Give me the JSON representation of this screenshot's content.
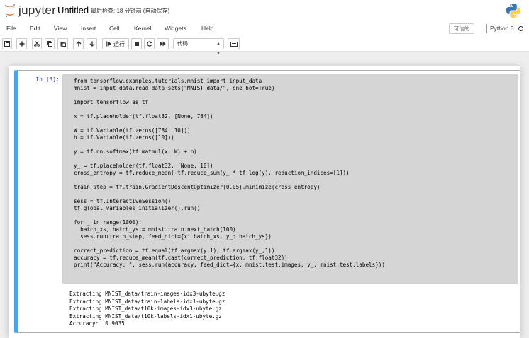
{
  "header": {
    "logo_text": "jupyter",
    "notebook_name": "Untitled",
    "checkpoint": "最后检查: 18 分钟前  (自动保存)"
  },
  "menubar": {
    "items": [
      "File",
      "Edit",
      "View",
      "Insert",
      "Cell",
      "Kernel",
      "Widgets",
      "Help"
    ],
    "trusted": "可信的",
    "kernel_name": "Python 3"
  },
  "toolbar": {
    "run_label": "运行",
    "cell_type": "代码"
  },
  "cell": {
    "prompt": "In [3]:",
    "code": "from tensorflow.examples.tutorials.mnist import input_data\nmnist = input_data.read_data_sets(\"MNIST_data/\", one_hot=True)\n\nimport tensorflow as tf\n\nx = tf.placeholder(tf.float32, [None, 784])\n\nW = tf.Variable(tf.zeros([784, 10]))\nb = tf.Variable(tf.zeros([10]))\n\ny = tf.nn.softmax(tf.matmul(x, W) + b)\n\ny_ = tf.placeholder(tf.float32, [None, 10])\ncross_entropy = tf.reduce_mean(-tf.reduce_sum(y_ * tf.log(y), reduction_indices=[1]))\n\ntrain_step = tf.train.GradientDescentOptimizer(0.05).minimize(cross_entropy)\n\nsess = tf.InteractiveSession()\ntf.global_variables_initializer().run()\n\nfor _ in range(1000):\n  batch_xs, batch_ys = mnist.train.next_batch(100)\n  sess.run(train_step, feed_dict={x: batch_xs, y_: batch_ys})\n\ncorrect_prediction = tf.equal(tf.argmax(y,1), tf.argmax(y_,1))\naccuracy = tf.reduce_mean(tf.cast(correct_prediction, tf.float32))\nprint(\"Accuracy: \", sess.run(accuracy, feed_dict={x: mnist.test.images, y_: mnist.test.labels}))",
    "output": "Extracting MNIST_data/train-images-idx3-ubyte.gz\nExtracting MNIST_data/train-labels-idx1-ubyte.gz\nExtracting MNIST_data/t10k-images-idx3-ubyte.gz\nExtracting MNIST_data/t10k-labels-idx1-ubyte.gz\nAccuracy:  0.9035"
  },
  "colors": {
    "accent_cell_border": "#42a5f5",
    "prompt_in": "#303f9f",
    "code_background": "#d5d5d5"
  },
  "icons": [
    "jupyter-logo-icon",
    "python-logo-icon",
    "save-icon",
    "plus-icon",
    "cut-icon",
    "copy-icon",
    "paste-icon",
    "arrow-up-icon",
    "arrow-down-icon",
    "run-icon",
    "stop-icon",
    "restart-icon",
    "fast-forward-icon",
    "keyboard-icon"
  ]
}
